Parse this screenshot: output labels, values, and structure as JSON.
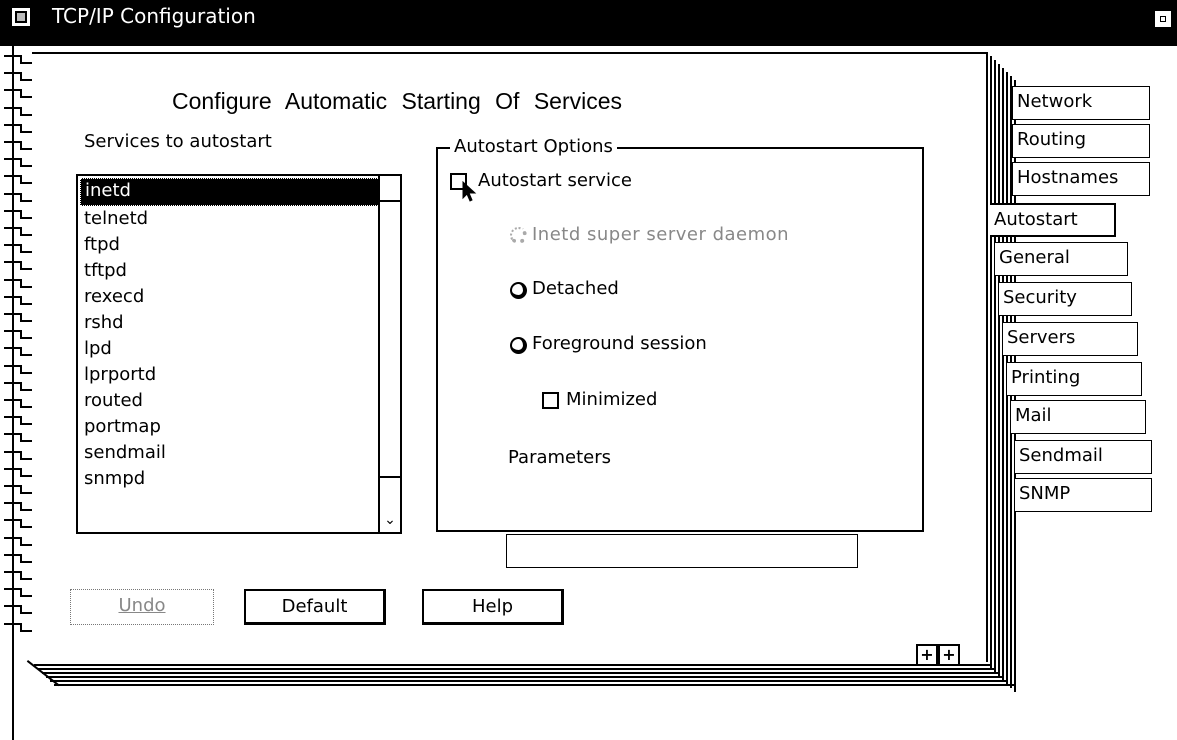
{
  "window": {
    "title": "TCP/IP Configuration"
  },
  "page": {
    "heading": "Configure Automatic Starting Of Services",
    "services_label": "Services to autostart",
    "services": [
      "inetd",
      "telnetd",
      "ftpd",
      "tftpd",
      "rexecd",
      "rshd",
      "lpd",
      "lprportd",
      "routed",
      "portmap",
      "sendmail",
      "snmpd"
    ],
    "selected_service": "inetd"
  },
  "options": {
    "group_label": "Autostart Options",
    "autostart_label": "Autostart service",
    "autostart_checked": false,
    "inetd_label": "Inetd super server daemon",
    "detached_label": "Detached",
    "foreground_label": "Foreground session",
    "minimized_label": "Minimized",
    "parameters_label": "Parameters",
    "parameters_value": ""
  },
  "buttons": {
    "undo": "Undo",
    "default": "Default",
    "help": "Help"
  },
  "page_arrows": {
    "prev": "+",
    "next": "+"
  },
  "tabs": [
    {
      "label": "Network",
      "active": false
    },
    {
      "label": "Routing",
      "active": false
    },
    {
      "label": "Hostnames",
      "active": false
    },
    {
      "label": "Autostart",
      "active": true
    },
    {
      "label": "General",
      "active": false
    },
    {
      "label": "Security",
      "active": false
    },
    {
      "label": "Servers",
      "active": false
    },
    {
      "label": "Printing",
      "active": false
    },
    {
      "label": "Mail",
      "active": false
    },
    {
      "label": "Sendmail",
      "active": false
    },
    {
      "label": "SNMP",
      "active": false
    }
  ]
}
